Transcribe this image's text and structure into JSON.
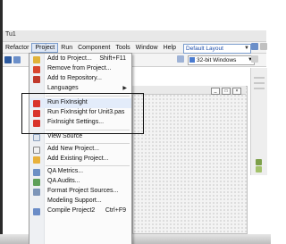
{
  "titlebar": {
    "text": "Tu1"
  },
  "menubar": {
    "items": [
      {
        "label": "Refactor"
      },
      {
        "label": "Project"
      },
      {
        "label": "Run"
      },
      {
        "label": "Component"
      },
      {
        "label": "Tools"
      },
      {
        "label": "Window"
      },
      {
        "label": "Help"
      }
    ],
    "layout_select": "Default Layout"
  },
  "toolbar": {
    "platform_select": "32-bit Windows"
  },
  "project_menu": {
    "items": [
      {
        "label": "Add to Project...",
        "shortcut": "Shift+F11",
        "icon": "add-to-project-icon"
      },
      {
        "label": "Remove from Project...",
        "shortcut": "",
        "icon": "remove-from-project-icon"
      },
      {
        "label": "Add to Repository...",
        "shortcut": "",
        "icon": "add-to-repository-icon"
      },
      {
        "label": "Languages",
        "shortcut": "",
        "icon": "",
        "submenu": "▶"
      },
      {
        "label": "Run FixInsight",
        "shortcut": "",
        "icon": "fixinsight-icon"
      },
      {
        "label": "Run FixInsight for Unit3.pas",
        "shortcut": "",
        "icon": "fixinsight-icon"
      },
      {
        "label": "FixInsight Settings...",
        "shortcut": "",
        "icon": "fixinsight-settings-icon"
      },
      {
        "label": "View Source",
        "shortcut": "",
        "icon": "view-source-icon"
      },
      {
        "label": "Add New Project...",
        "shortcut": "",
        "icon": "add-new-project-icon"
      },
      {
        "label": "Add Existing Project...",
        "shortcut": "",
        "icon": "add-existing-project-icon"
      },
      {
        "label": "QA Metrics...",
        "shortcut": "",
        "icon": "qa-metrics-icon"
      },
      {
        "label": "QA Audits...",
        "shortcut": "",
        "icon": "qa-audits-icon"
      },
      {
        "label": "Format Project Sources...",
        "shortcut": "",
        "icon": "format-sources-icon"
      },
      {
        "label": "Modeling Support...",
        "shortcut": "",
        "icon": "modeling-support-icon"
      },
      {
        "label": "Compile Project2",
        "shortcut": "Ctrl+F9",
        "icon": "compile-icon"
      }
    ]
  },
  "colors": {
    "menu_highlight": "#e3ecfa",
    "fixinsight_red": "#d9342b",
    "layout_select_text": "#1a4aa8"
  }
}
